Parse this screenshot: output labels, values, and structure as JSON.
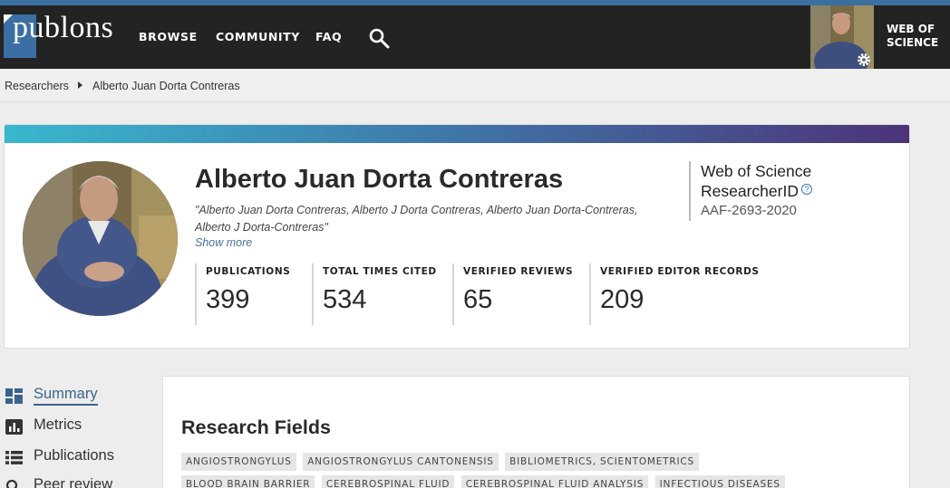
{
  "nav": {
    "logo_text": "publons",
    "items": [
      "BROWSE",
      "COMMUNITY",
      "FAQ"
    ],
    "wos_line1": "WEB OF",
    "wos_line2": "SCIENCE"
  },
  "breadcrumb": {
    "parent": "Researchers",
    "current": "Alberto Juan Dorta Contreras"
  },
  "profile": {
    "name": "Alberto Juan Dorta Contreras",
    "aliases": "\"Alberto Juan Dorta Contreras, Alberto J Dorta Contreras, Alberto Juan Dorta-Contreras, Alberto J Dorta-Contreras\"",
    "show_more": "Show more",
    "researcher_id_line1": "Web of Science",
    "researcher_id_line2": "ResearcherID",
    "help_glyph": "?",
    "researcher_id": "AAF-2693-2020",
    "stats": [
      {
        "label": "PUBLICATIONS",
        "value": "399"
      },
      {
        "label": "TOTAL TIMES CITED",
        "value": "534"
      },
      {
        "label": "VERIFIED REVIEWS",
        "value": "65"
      },
      {
        "label": "VERIFIED EDITOR RECORDS",
        "value": "209"
      }
    ]
  },
  "sidebar": {
    "items": [
      {
        "label": "Summary",
        "icon": "dashboard-icon"
      },
      {
        "label": "Metrics",
        "icon": "bar-chart-icon"
      },
      {
        "label": "Publications",
        "icon": "list-icon"
      },
      {
        "label": "Peer review",
        "icon": "search-icon"
      }
    ]
  },
  "fields": {
    "title": "Research Fields",
    "tags": [
      "ANGIOSTRONGYLUS",
      "ANGIOSTRONGYLUS CANTONENSIS",
      "BIBLIOMETRICS, SCIENTOMETRICS",
      "BLOOD BRAIN BARRIER",
      "CEREBROSPINAL FLUID",
      "CEREBROSPINAL FLUID ANALYSIS",
      "INFECTIOUS DISEASES"
    ]
  },
  "colors": {
    "nav_bg": "#232323",
    "accent": "#3a6490",
    "gradient_start": "#3ab7cf",
    "gradient_end": "#4d3379"
  }
}
